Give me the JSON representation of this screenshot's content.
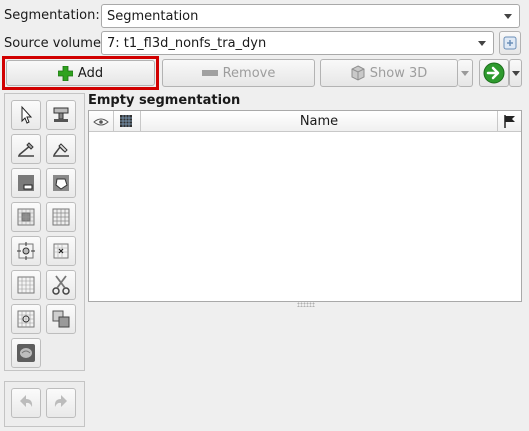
{
  "segmentation_row": {
    "label": "Segmentation:",
    "selected": "Segmentation"
  },
  "source_row": {
    "label": "Source volume:",
    "selected": "7: t1_fl3d_nonfs_tra_dyn"
  },
  "actions": {
    "add_label": "Add",
    "remove_label": "Remove",
    "show3d_label": "Show 3D"
  },
  "segments": {
    "title": "Empty segmentation",
    "columns": {
      "name": "Name"
    },
    "rows": []
  },
  "colors": {
    "add_highlight": "#d10000",
    "add_plus": "#2fa21f",
    "go_arrow": "#2e9a2e"
  },
  "icons": {
    "tools": [
      "pointer-icon",
      "paint-icon",
      "draw-icon",
      "erase-icon",
      "level-tracing-icon",
      "grow-from-seeds-icon",
      "margin-icon",
      "hollow-icon",
      "smoothing-icon",
      "threshold-icon",
      "islands-icon",
      "logical-operators-icon",
      "mask-volume-icon",
      "scissors-icon",
      "local-threshold-icon",
      "fill-between-slices-icon",
      "watershed-icon"
    ]
  }
}
